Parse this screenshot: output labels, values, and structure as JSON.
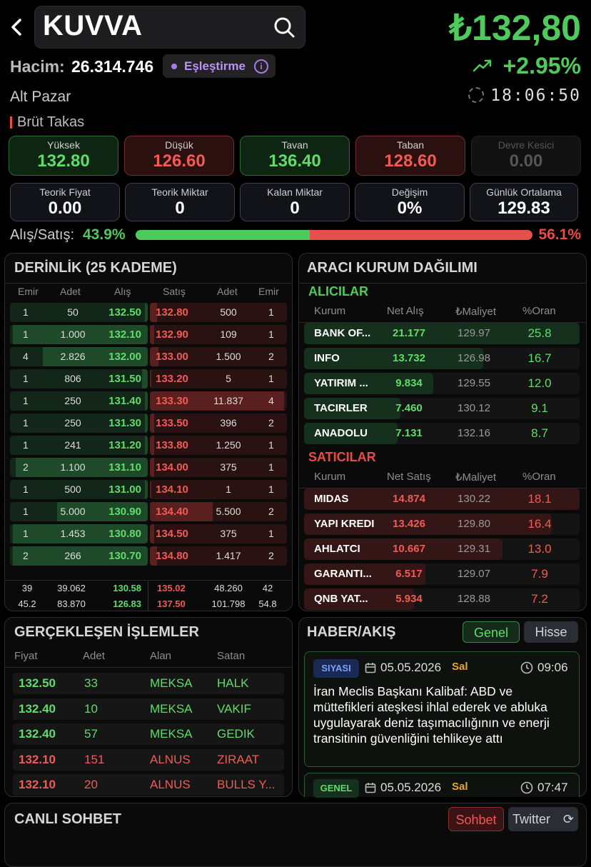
{
  "header": {
    "symbol": "KUVVA",
    "price": "₺132,80",
    "volume_label": "Hacim:",
    "volume": "26.314.746",
    "badge": "Eşleştirme",
    "change": "+2.95%",
    "market": "Alt Pazar",
    "time": "18:06:50",
    "takas": "Brüt Takas"
  },
  "stats_row1": [
    {
      "label": "Yüksek",
      "value": "132.80",
      "tone": "g"
    },
    {
      "label": "Düşük",
      "value": "126.60",
      "tone": "r"
    },
    {
      "label": "Tavan",
      "value": "136.40",
      "tone": "g"
    },
    {
      "label": "Taban",
      "value": "128.60",
      "tone": "r"
    },
    {
      "label": "Devre Kesici",
      "value": "0.00",
      "tone": "d"
    }
  ],
  "stats_row2": [
    {
      "label": "Teorik Fiyat",
      "value": "0.00"
    },
    {
      "label": "Teorik Miktar",
      "value": "0"
    },
    {
      "label": "Kalan Miktar",
      "value": "0"
    },
    {
      "label": "Değişim",
      "value": "0%"
    },
    {
      "label": "Günlük Ortalama",
      "value": "129.83"
    }
  ],
  "ratio": {
    "label": "Alış/Satış:",
    "buy": "43.9%",
    "sell": "56.1%",
    "buy_fraction": 0.439
  },
  "depth": {
    "title": "DERİNLİK (25 KADEME)",
    "headers": [
      "Emir",
      "Adet",
      "Alış",
      "Satış",
      "Adet",
      "Emir"
    ],
    "rows": [
      {
        "be": "1",
        "ba": "50",
        "bp": "132.50",
        "ap": "132.80",
        "aa": "500",
        "ae": "1",
        "bf": 0.02,
        "af": 0.05
      },
      {
        "be": "1",
        "ba": "1.000",
        "bp": "132.10",
        "ap": "132.90",
        "aa": "109",
        "ae": "1",
        "bf": 0.98,
        "af": 0.03
      },
      {
        "be": "4",
        "ba": "2.826",
        "bp": "132.00",
        "ap": "133.00",
        "aa": "1.500",
        "ae": "2",
        "bf": 0.76,
        "af": 0.06
      },
      {
        "be": "1",
        "ba": "806",
        "bp": "131.50",
        "ap": "133.20",
        "aa": "5",
        "ae": "1",
        "bf": 0.04,
        "af": 0.01
      },
      {
        "be": "1",
        "ba": "250",
        "bp": "131.40",
        "ap": "133.30",
        "aa": "11.837",
        "ae": "4",
        "bf": 0.02,
        "af": 0.98
      },
      {
        "be": "1",
        "ba": "250",
        "bp": "131.30",
        "ap": "133.50",
        "aa": "396",
        "ae": "2",
        "bf": 0.02,
        "af": 0.03
      },
      {
        "be": "1",
        "ba": "241",
        "bp": "131.20",
        "ap": "133.80",
        "aa": "1.250",
        "ae": "1",
        "bf": 0.02,
        "af": 0.03
      },
      {
        "be": "2",
        "ba": "1.100",
        "bp": "131.10",
        "ap": "134.00",
        "aa": "375",
        "ae": "1",
        "bf": 0.96,
        "af": 0.03
      },
      {
        "be": "1",
        "ba": "500",
        "bp": "131.00",
        "ap": "134.10",
        "aa": "1",
        "ae": "1",
        "bf": 0.02,
        "af": 0.01
      },
      {
        "be": "1",
        "ba": "5.000",
        "bp": "130.90",
        "ap": "134.40",
        "aa": "5.500",
        "ae": "2",
        "bf": 0.66,
        "af": 0.46
      },
      {
        "be": "1",
        "ba": "1.453",
        "bp": "130.80",
        "ap": "134.50",
        "aa": "375",
        "ae": "1",
        "bf": 0.98,
        "af": 0.03
      },
      {
        "be": "2",
        "ba": "266",
        "bp": "130.70",
        "ap": "134.80",
        "aa": "1.417",
        "ae": "2",
        "bf": 0.98,
        "af": 0.05
      }
    ],
    "totals": [
      {
        "be": "39",
        "ba": "39.062",
        "bp": "130.58",
        "ap": "135.02",
        "aa": "48.260",
        "ae": "42"
      },
      {
        "be": "45.2",
        "ba": "83.870",
        "bp": "126.83",
        "ap": "137.50",
        "aa": "101.798",
        "ae": "54.8"
      }
    ]
  },
  "brokers": {
    "title": "ARACI KURUM DAĞILIMI",
    "buyers_title": "ALICILAR",
    "buyers_headers": [
      "Kurum",
      "Net Alış",
      "₺Maliyet",
      "%Oran"
    ],
    "buyers": [
      {
        "name": "BANK OF...",
        "net": "21.177",
        "cost": "129.97",
        "ratio": "25.8",
        "fill": 1.0
      },
      {
        "name": "INFO",
        "net": "13.732",
        "cost": "126.98",
        "ratio": "16.7",
        "fill": 0.65
      },
      {
        "name": "YATIRIM ...",
        "net": "9.834",
        "cost": "129.55",
        "ratio": "12.0",
        "fill": 0.47
      },
      {
        "name": "TACIRLER",
        "net": "7.460",
        "cost": "130.12",
        "ratio": "9.1",
        "fill": 0.35
      },
      {
        "name": "ANADOLU",
        "net": "7.131",
        "cost": "132.16",
        "ratio": "8.7",
        "fill": 0.34
      }
    ],
    "sellers_title": "SATICILAR",
    "sellers_headers": [
      "Kurum",
      "Net Satış",
      "₺Maliyet",
      "%Oran"
    ],
    "sellers": [
      {
        "name": "MIDAS",
        "net": "14.874",
        "cost": "130.22",
        "ratio": "18.1",
        "fill": 1.0
      },
      {
        "name": "YAPI KREDI",
        "net": "13.426",
        "cost": "129.80",
        "ratio": "16.4",
        "fill": 0.9
      },
      {
        "name": "AHLATCI",
        "net": "10.667",
        "cost": "129.31",
        "ratio": "13.0",
        "fill": 0.72
      },
      {
        "name": "GARANTI...",
        "net": "6.517",
        "cost": "129.07",
        "ratio": "7.9",
        "fill": 0.44
      },
      {
        "name": "QNB YAT...",
        "net": "5.934",
        "cost": "128.88",
        "ratio": "7.2",
        "fill": 0.4
      }
    ]
  },
  "trades": {
    "title": "GERÇEKLEŞEN İŞLEMLER",
    "headers": [
      "Fiyat",
      "Adet",
      "Alan",
      "Satan"
    ],
    "rows": [
      {
        "price": "132.50",
        "qty": "33",
        "buyer": "MEKSA",
        "seller": "HALK",
        "side": "g"
      },
      {
        "price": "132.40",
        "qty": "10",
        "buyer": "MEKSA",
        "seller": "VAKIF",
        "side": "g"
      },
      {
        "price": "132.40",
        "qty": "57",
        "buyer": "MEKSA",
        "seller": "GEDIK",
        "side": "g"
      },
      {
        "price": "132.10",
        "qty": "151",
        "buyer": "ALNUS",
        "seller": "ZIRAAT",
        "side": "r"
      },
      {
        "price": "132.10",
        "qty": "20",
        "buyer": "ALNUS",
        "seller": "BULLS Y...",
        "side": "r"
      }
    ]
  },
  "news": {
    "title": "HABER/AKIŞ",
    "tab_general": "Genel",
    "tab_stock": "Hisse",
    "items": [
      {
        "tag": "SIYASI",
        "date": "05.05.2026",
        "day": "Sal",
        "time": "09:06",
        "text": "İran Meclis Başkanı Kalibaf: ABD ve müttefikleri ateşkesi ihlal ederek ve abluka uygulayarak deniz taşımacılığının ve enerji transitinin güvenliğini tehlikeye attı"
      },
      {
        "tag": "GENEL",
        "date": "05.05.2026",
        "day": "Sal",
        "time": "07:47",
        "text": ""
      }
    ]
  },
  "chat": {
    "title": "CANLI SOHBET",
    "tab_chat": "Sohbet",
    "tab_twitter": "Twitter"
  },
  "colors": {
    "up": "#4ecb5a",
    "down": "#ec4a45",
    "badge": "#a77be6"
  }
}
